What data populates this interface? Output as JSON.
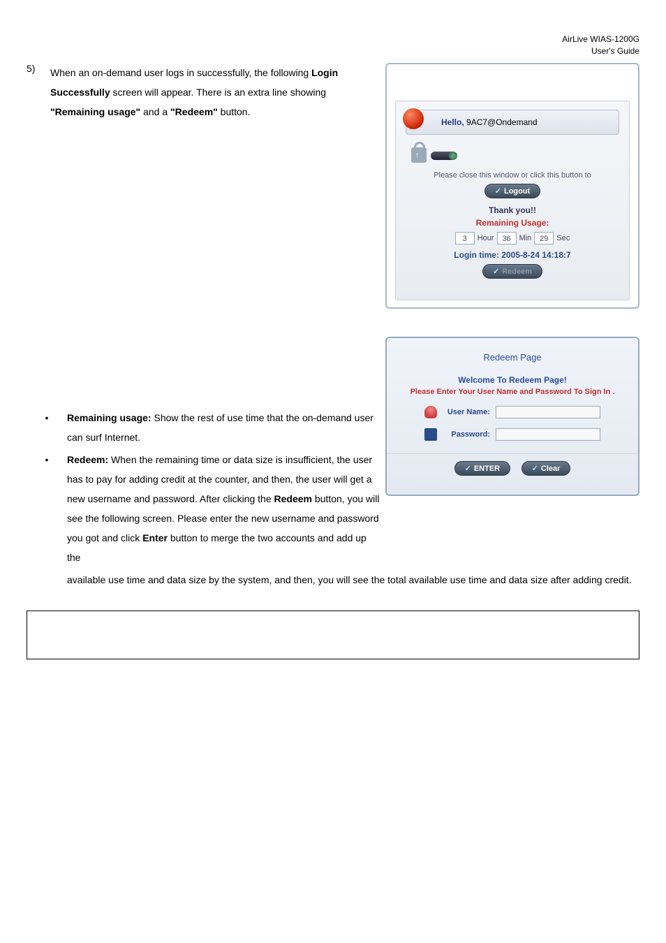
{
  "header": {
    "product": "AirLive  WIAS-1200G",
    "doc": "User's Guide"
  },
  "main": {
    "item_num": "5)",
    "line1_a": "When an on-demand user logs in successfully, the",
    "line2_a": "following",
    "line2_b": "Login Successfully",
    "line2_c": "screen will appear. There is",
    "line3_a": "an extra line showing",
    "line3_b": "\"Remaining usage\"",
    "line3_c": "and a",
    "line4_a": "\"Redeem\"",
    "line4_b": "button."
  },
  "bullets": {
    "b1_title": "Remaining usage:",
    "b1_text_a": "Show the rest of use time that the",
    "b1_text_b": "on-demand user can surf Internet.",
    "b2_title": "Redeem:",
    "b2_text_a": "When the remaining time or data size is",
    "b2_text_b": "insufficient, the user has to pay for adding credit at the counter, and then, the user will get a new username and password. After clicking the",
    "b2_redeem": "Redeem",
    "b2_text_c": "button, you will see the following screen. Please enter the new username and password you got and click",
    "b2_enter": "Enter",
    "b2_text_d": "button to merge the two accounts and add up the",
    "b2_full": "available use time and data size by the system, and then, you will see the total available use time and data size after adding credit."
  },
  "logout": {
    "hello_label": "Hello,",
    "hello_user": "9AC7@Ondemand",
    "please": "Please close this window or click this button to",
    "logout_btn": "Logout",
    "thank": "Thank you!!",
    "remaining": "Remaining Usage:",
    "hour_val": "3",
    "hour_label": "Hour",
    "min_val": "36",
    "min_label": "Min",
    "sec_val": "29",
    "sec_label": "Sec",
    "login_time": "Login time: 2005-8-24 14:18:7",
    "redeem_btn": "Redeem"
  },
  "redeem": {
    "title": "Redeem Page",
    "welcome": "Welcome To Redeem Page!",
    "please": "Please Enter Your User Name and Password To Sign In .",
    "user_label": "User Name:",
    "pass_label": "Password:",
    "enter_btn": "ENTER",
    "clear_btn": "Clear"
  }
}
